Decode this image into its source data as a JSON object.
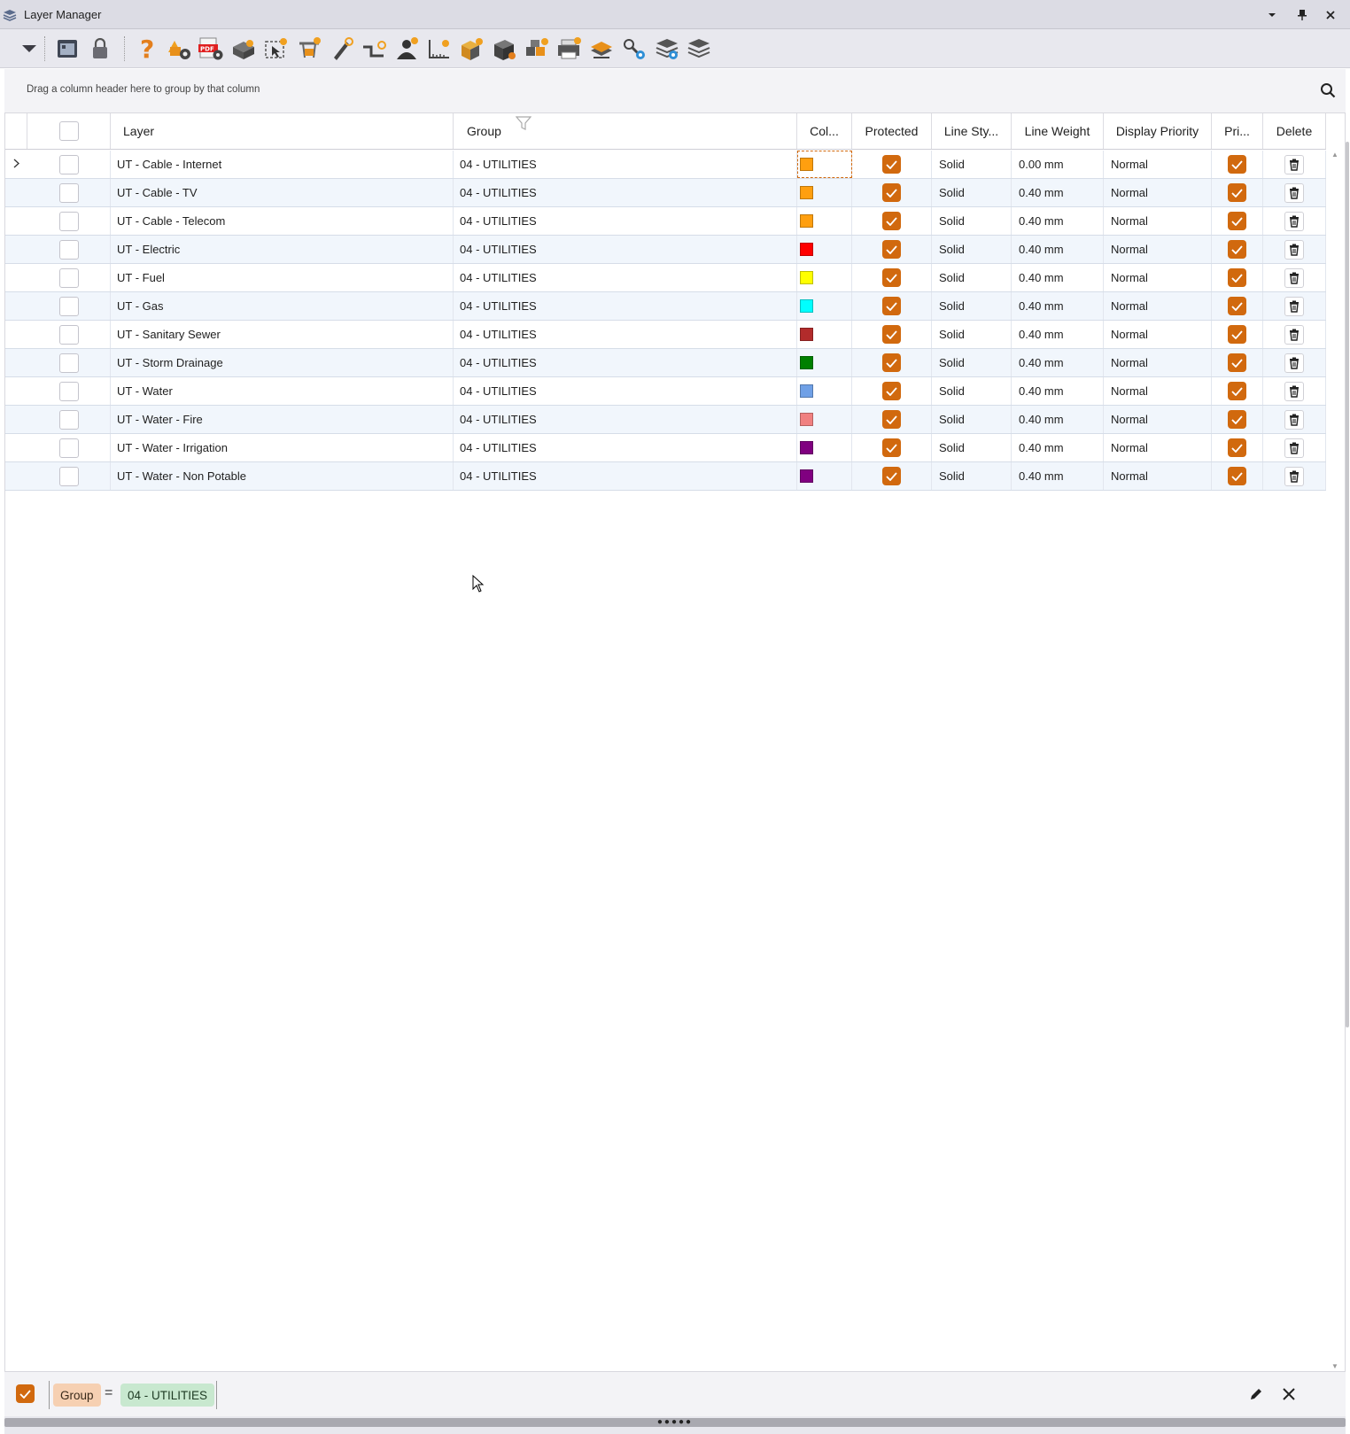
{
  "window": {
    "title": "Layer Manager",
    "controls": [
      "chevron-down-icon",
      "pin-icon",
      "close-icon"
    ]
  },
  "toolbar": {
    "icons": [
      "dropdown-arrow-icon",
      "layer-window-icon",
      "lock-icon",
      "help-icon",
      "layer-settings-icon",
      "pdf-export-icon",
      "3d-model-icon",
      "selection-icon",
      "hanger-icon",
      "pen-icon",
      "pipe-icon",
      "person-icon",
      "ruler-icon",
      "box-icon",
      "solid-box-icon",
      "boxes-icon",
      "printer-icon",
      "layers-export-icon",
      "tools-icon",
      "layers-stack-settings-icon",
      "layers-stack-icon"
    ]
  },
  "group_panel": {
    "hint": "Drag a column header here to group by that column"
  },
  "columns": {
    "layer": "Layer",
    "group": "Group",
    "color": "Col...",
    "protected": "Protected",
    "line_style": "Line Sty...",
    "line_weight": "Line Weight",
    "display_priority": "Display Priority",
    "print": "Pri...",
    "delete": "Delete"
  },
  "rows": [
    {
      "layer": "UT - Cable - Internet",
      "group": "04 - UTILITIES",
      "color": "#FF9F0F",
      "protected": true,
      "line_style": "Solid",
      "line_weight": "0.00 mm",
      "display_priority": "Normal",
      "print": true
    },
    {
      "layer": "UT - Cable - TV",
      "group": "04 - UTILITIES",
      "color": "#FF9F0F",
      "protected": true,
      "line_style": "Solid",
      "line_weight": "0.40 mm",
      "display_priority": "Normal",
      "print": true
    },
    {
      "layer": "UT - Cable - Telecom",
      "group": "04 - UTILITIES",
      "color": "#FF9F0F",
      "protected": true,
      "line_style": "Solid",
      "line_weight": "0.40 mm",
      "display_priority": "Normal",
      "print": true
    },
    {
      "layer": "UT - Electric",
      "group": "04 - UTILITIES",
      "color": "#FF0000",
      "protected": true,
      "line_style": "Solid",
      "line_weight": "0.40 mm",
      "display_priority": "Normal",
      "print": true
    },
    {
      "layer": "UT - Fuel",
      "group": "04 - UTILITIES",
      "color": "#FFFF00",
      "protected": true,
      "line_style": "Solid",
      "line_weight": "0.40 mm",
      "display_priority": "Normal",
      "print": true
    },
    {
      "layer": "UT - Gas",
      "group": "04 - UTILITIES",
      "color": "#00FFFF",
      "protected": true,
      "line_style": "Solid",
      "line_weight": "0.40 mm",
      "display_priority": "Normal",
      "print": true
    },
    {
      "layer": "UT - Sanitary Sewer",
      "group": "04 - UTILITIES",
      "color": "#B22B2B",
      "protected": true,
      "line_style": "Solid",
      "line_weight": "0.40 mm",
      "display_priority": "Normal",
      "print": true
    },
    {
      "layer": "UT - Storm Drainage",
      "group": "04 - UTILITIES",
      "color": "#008000",
      "protected": true,
      "line_style": "Solid",
      "line_weight": "0.40 mm",
      "display_priority": "Normal",
      "print": true
    },
    {
      "layer": "UT - Water",
      "group": "04 - UTILITIES",
      "color": "#6FA0E6",
      "protected": true,
      "line_style": "Solid",
      "line_weight": "0.40 mm",
      "display_priority": "Normal",
      "print": true
    },
    {
      "layer": "UT - Water - Fire",
      "group": "04 - UTILITIES",
      "color": "#F08080",
      "protected": true,
      "line_style": "Solid",
      "line_weight": "0.40 mm",
      "display_priority": "Normal",
      "print": true
    },
    {
      "layer": "UT - Water - Irrigation",
      "group": "04 - UTILITIES",
      "color": "#800080",
      "protected": true,
      "line_style": "Solid",
      "line_weight": "0.40 mm",
      "display_priority": "Normal",
      "print": true
    },
    {
      "layer": "UT - Water - Non Potable",
      "group": "04 - UTILITIES",
      "color": "#800080",
      "protected": true,
      "line_style": "Solid",
      "line_weight": "0.40 mm",
      "display_priority": "Normal",
      "print": true
    }
  ],
  "filter": {
    "enabled": true,
    "field": "Group",
    "operator": "=",
    "value": "04 - UTILITIES"
  },
  "colors": {
    "accent": "#D1690E",
    "row_alt": "#F1F6FC",
    "title_bar": "#DCDCE4"
  }
}
